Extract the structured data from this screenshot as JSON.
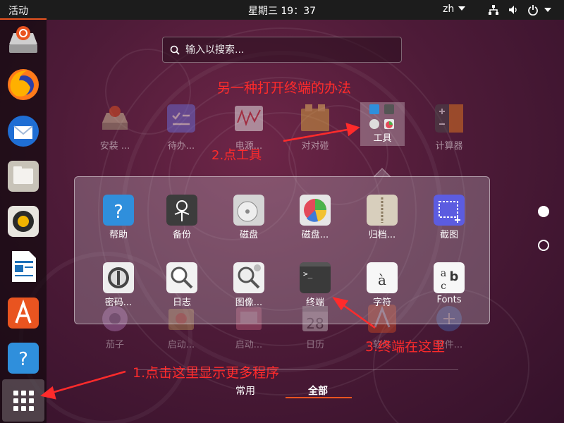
{
  "topbar": {
    "activities": "活动",
    "clock": "星期三 19：37",
    "language": "zh",
    "tray_icons": [
      "network-icon",
      "volume-icon",
      "power-icon"
    ]
  },
  "dock": {
    "items": [
      "installer-icon",
      "firefox-icon",
      "thunderbird-icon",
      "files-icon",
      "rhythmbox-icon",
      "writer-icon",
      "software-center-icon",
      "help-icon"
    ],
    "show_apps_icon": "grid-icon"
  },
  "search": {
    "placeholder": "输入以搜索..."
  },
  "annotations": {
    "title": "另一种打开终端的办法",
    "step1": "1.点击这里显示更多程序",
    "step2": "2.点工具",
    "step3": "3.终端在这里",
    "color": "#ff2b2b"
  },
  "app_row": [
    {
      "label": "安装 ...",
      "icon": "installer-icon"
    },
    {
      "label": "待办...",
      "icon": "todo-icon"
    },
    {
      "label": "电源...",
      "icon": "power-stats-icon"
    },
    {
      "label": "对对碰",
      "icon": "game-icon"
    },
    {
      "label": "工具",
      "icon": "tools-folder-icon"
    },
    {
      "label": "计算器",
      "icon": "calculator-icon"
    }
  ],
  "folder_apps": [
    {
      "label": "帮助",
      "icon": "help-icon"
    },
    {
      "label": "备份",
      "icon": "backup-icon"
    },
    {
      "label": "磁盘",
      "icon": "disks-icon"
    },
    {
      "label": "磁盘...",
      "icon": "disk-usage-icon"
    },
    {
      "label": "归档...",
      "icon": "archive-icon"
    },
    {
      "label": "截图",
      "icon": "screenshot-icon"
    },
    {
      "label": "密码...",
      "icon": "passwords-icon"
    },
    {
      "label": "日志",
      "icon": "logs-icon"
    },
    {
      "label": "图像...",
      "icon": "image-viewer-icon"
    },
    {
      "label": "终端",
      "icon": "terminal-icon"
    },
    {
      "label": "字符",
      "icon": "characters-icon"
    },
    {
      "label": "Fonts",
      "icon": "fonts-icon"
    }
  ],
  "bottom_row": [
    {
      "label": "茄子",
      "icon": "cheese-icon"
    },
    {
      "label": "启动...",
      "icon": "startup-icon"
    },
    {
      "label": "启动...",
      "icon": "startup-disk-icon"
    },
    {
      "label": "日历",
      "icon": "calendar-icon",
      "number": "28"
    },
    {
      "label": "软件",
      "icon": "software-icon"
    },
    {
      "label": "软件...",
      "icon": "software-updater-icon"
    }
  ],
  "tabs": {
    "frequent": "常用",
    "all": "全部",
    "active": "全部"
  },
  "colors": {
    "accent": "#e95420",
    "topbar": "#1c1c1c"
  }
}
